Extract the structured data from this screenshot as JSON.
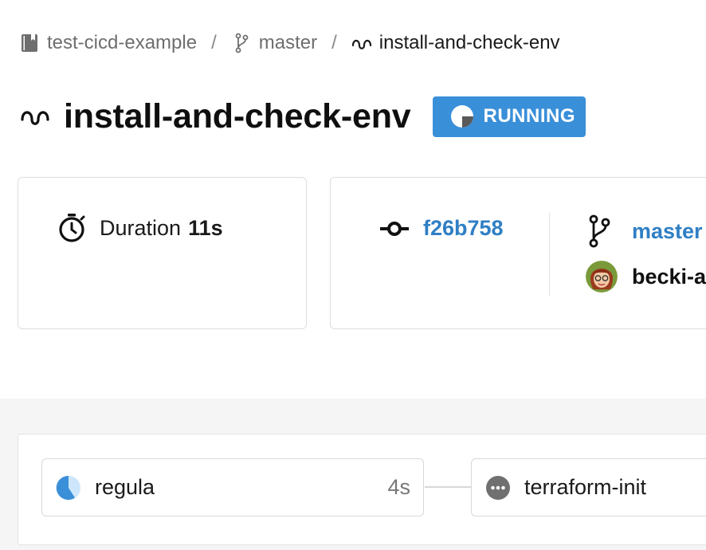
{
  "breadcrumb": {
    "repo": "test-cicd-example",
    "branch": "master",
    "workflow": "install-and-check-env",
    "separator": "/"
  },
  "title": "install-and-check-env",
  "status": {
    "label": "RUNNING",
    "color": "#3a8fd9"
  },
  "duration": {
    "label": "Duration",
    "value": "11s"
  },
  "commit": {
    "hash": "f26b758",
    "branch": "master",
    "author": "becki-a"
  },
  "pipeline": {
    "steps": [
      {
        "name": "regula",
        "duration": "4s",
        "state": "running"
      },
      {
        "name": "terraform-init",
        "state": "pending"
      }
    ]
  },
  "colors": {
    "link": "#2f7fc4",
    "running": "#3a8fd9",
    "pending": "#707070"
  }
}
